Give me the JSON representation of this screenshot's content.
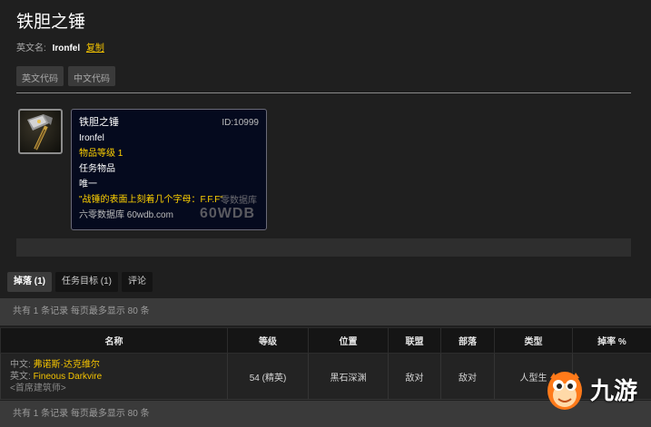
{
  "header": {
    "title": "铁胆之锤",
    "en_label": "英文名:",
    "en_value": "Ironfel",
    "copy_label": "复制"
  },
  "code_buttons": [
    "英文代码",
    "中文代码"
  ],
  "tooltip": {
    "name": "铁胆之锤",
    "id": "ID:10999",
    "english_name": "Ironfel",
    "item_level": "物品等级 1",
    "item_type": "任务物品",
    "unique": "唯一",
    "flavor": "\"战锤的表面上刻着几个字母：F.F.F\"",
    "source": "六零数据库 60wdb.com",
    "watermark_small": "零数据库",
    "watermark_big": "60WDB"
  },
  "tabs": [
    "掉落 (1)",
    "任务目标 (1)",
    "评论"
  ],
  "summary_text": "共有 1 条记录 每页最多显示 80 条",
  "table": {
    "headers": [
      "名称",
      "等级",
      "位置",
      "联盟",
      "部落",
      "类型",
      "掉率 %"
    ],
    "rows": [
      {
        "cn_label": "中文:",
        "cn_name": "弗诺斯·达克维尔",
        "en_label": "英文:",
        "en_name": "Fineous Darkvire",
        "subtitle": "<首席建筑师>",
        "level": "54 (精英)",
        "location": "黑石深渊",
        "alliance": "敌对",
        "horde": "敌对",
        "type": "人型生"
      }
    ]
  },
  "brand": {
    "logo_text": "九游"
  },
  "colors": {
    "accent_yellow": "#f5c400",
    "hostile_red": "#e02020",
    "tooltip_bg": "#050a1e"
  }
}
